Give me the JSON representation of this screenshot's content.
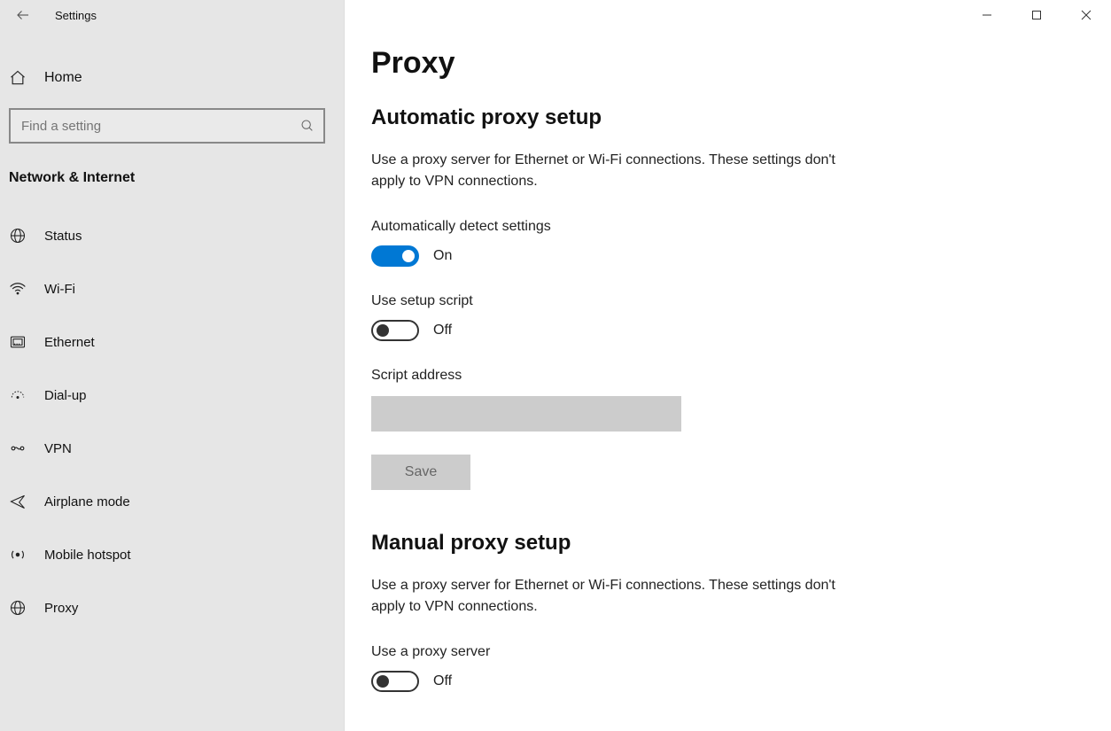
{
  "app_title": "Settings",
  "home_label": "Home",
  "search": {
    "placeholder": "Find a setting"
  },
  "section_title": "Network & Internet",
  "nav": {
    "items": [
      {
        "label": "Status",
        "icon": "globe-icon"
      },
      {
        "label": "Wi-Fi",
        "icon": "wifi-icon"
      },
      {
        "label": "Ethernet",
        "icon": "ethernet-icon"
      },
      {
        "label": "Dial-up",
        "icon": "dial-up-icon"
      },
      {
        "label": "VPN",
        "icon": "vpn-icon"
      },
      {
        "label": "Airplane mode",
        "icon": "airplane-icon"
      },
      {
        "label": "Mobile hotspot",
        "icon": "hotspot-icon"
      },
      {
        "label": "Proxy",
        "icon": "proxy-icon"
      }
    ]
  },
  "page": {
    "title": "Proxy",
    "auto": {
      "heading": "Automatic proxy setup",
      "description": "Use a proxy server for Ethernet or Wi-Fi connections. These settings don't apply to VPN connections.",
      "detect_label": "Automatically detect settings",
      "detect_state_text": "On",
      "script_label": "Use setup script",
      "script_state_text": "Off",
      "script_address_label": "Script address",
      "script_address_value": "",
      "save_label": "Save"
    },
    "manual": {
      "heading": "Manual proxy setup",
      "description": "Use a proxy server for Ethernet or Wi-Fi connections. These settings don't apply to VPN connections.",
      "use_server_label": "Use a proxy server",
      "use_server_state_text": "Off"
    }
  },
  "colors": {
    "accent": "#0078d4"
  }
}
